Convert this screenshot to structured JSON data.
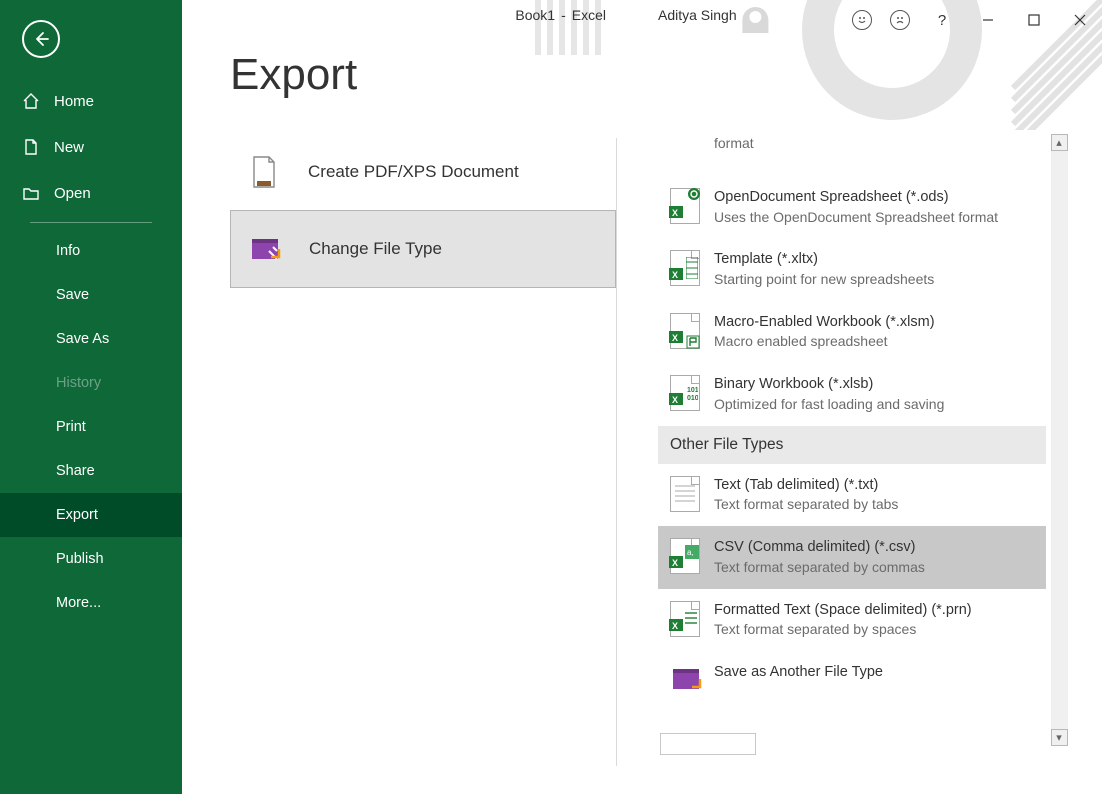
{
  "titlebar": {
    "doc": "Book1",
    "dash": "-",
    "app": "Excel",
    "user": "Aditya Singh",
    "help": "?"
  },
  "sidebar": {
    "home": "Home",
    "new": "New",
    "open": "Open",
    "info": "Info",
    "save": "Save",
    "saveas": "Save As",
    "history": "History",
    "print": "Print",
    "share": "Share",
    "export": "Export",
    "publish": "Publish",
    "more": "More..."
  },
  "page_title": "Export",
  "export_options": {
    "pdf": "Create PDF/XPS Document",
    "change": "Change File Type"
  },
  "file_types": {
    "partial_desc_top": "format",
    "ods": {
      "title": "OpenDocument Spreadsheet (*.ods)",
      "desc": "Uses the OpenDocument Spreadsheet format"
    },
    "xltx": {
      "title": "Template (*.xltx)",
      "desc": "Starting point for new spreadsheets"
    },
    "xlsm": {
      "title": "Macro-Enabled Workbook (*.xlsm)",
      "desc": "Macro enabled spreadsheet"
    },
    "xlsb": {
      "title": "Binary Workbook (*.xlsb)",
      "desc": "Optimized for fast loading and saving"
    },
    "section_other": "Other File Types",
    "txt": {
      "title": "Text (Tab delimited) (*.txt)",
      "desc": "Text format separated by tabs"
    },
    "csv": {
      "title": "CSV (Comma delimited) (*.csv)",
      "desc": "Text format separated by commas"
    },
    "prn": {
      "title": "Formatted Text (Space delimited) (*.prn)",
      "desc": "Text format separated by spaces"
    },
    "another": {
      "title": "Save as Another File Type"
    }
  }
}
